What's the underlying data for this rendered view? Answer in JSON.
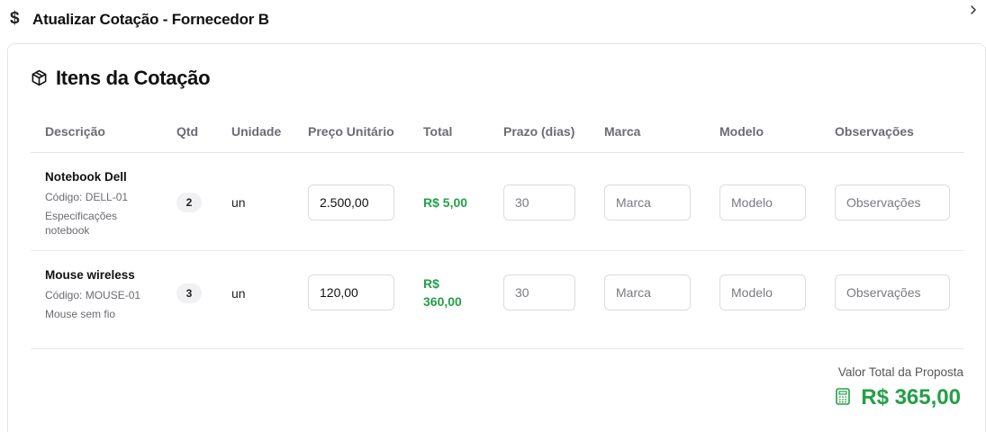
{
  "header": {
    "title": "Atualizar Cotação - Fornecedor B",
    "title_icon": "dollar-icon",
    "collapse_icon": "chevron-right-icon"
  },
  "card": {
    "title": "Itens da Cotação",
    "title_icon": "package-icon"
  },
  "table": {
    "columns": [
      "Descrição",
      "Qtd",
      "Unidade",
      "Preço Unitário",
      "Total",
      "Prazo (dias)",
      "Marca",
      "Modelo",
      "Observações"
    ],
    "rows": [
      {
        "name": "Notebook Dell",
        "code": "Código: DELL-01",
        "spec_line1": "Especificações",
        "spec_line2": "notebook",
        "qty": "2",
        "unit": "un",
        "unit_price": "2.500,00",
        "total_line1": "R$ 5,00",
        "total_line2": "",
        "deadline_placeholder": "30",
        "brand_placeholder": "Marca",
        "model_placeholder": "Modelo",
        "notes_placeholder": "Observações"
      },
      {
        "name": "Mouse wireless",
        "code": "Código: MOUSE-01",
        "spec_line1": "Mouse sem fio",
        "spec_line2": "",
        "qty": "3",
        "unit": "un",
        "unit_price": "120,00",
        "total_line1": "R$",
        "total_line2": "360,00",
        "deadline_placeholder": "30",
        "brand_placeholder": "Marca",
        "model_placeholder": "Modelo",
        "notes_placeholder": "Observações"
      }
    ]
  },
  "summary": {
    "label": "Valor Total da Proposta",
    "value": "R$ 365,00",
    "icon": "calculator-icon"
  },
  "colors": {
    "accent_green": "#22a047",
    "border": "#e4e4e7",
    "header_text": "#6b6b73"
  }
}
